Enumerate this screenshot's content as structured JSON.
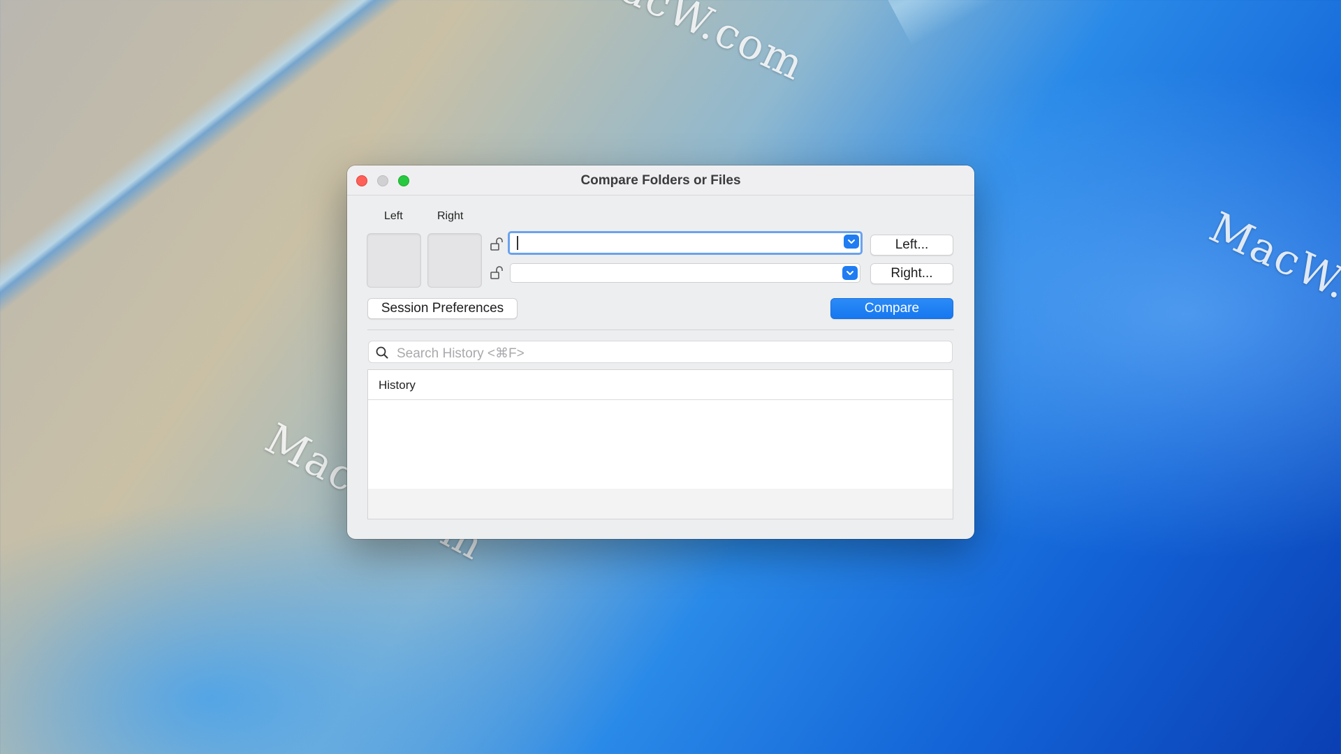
{
  "window": {
    "title": "Compare Folders or Files"
  },
  "selector": {
    "left_label": "Left",
    "right_label": "Right",
    "left_path_value": "",
    "right_path_value": "",
    "left_button": "Left...",
    "right_button": "Right..."
  },
  "actions": {
    "session_preferences": "Session Preferences",
    "compare": "Compare"
  },
  "search": {
    "placeholder": "Search History <⌘F>"
  },
  "history": {
    "column_header": "History",
    "rows": []
  },
  "watermark": {
    "text": "MacW.com"
  },
  "colors": {
    "accent": "#1f7cf2",
    "close": "#fe5f57",
    "maximize": "#28c840"
  }
}
